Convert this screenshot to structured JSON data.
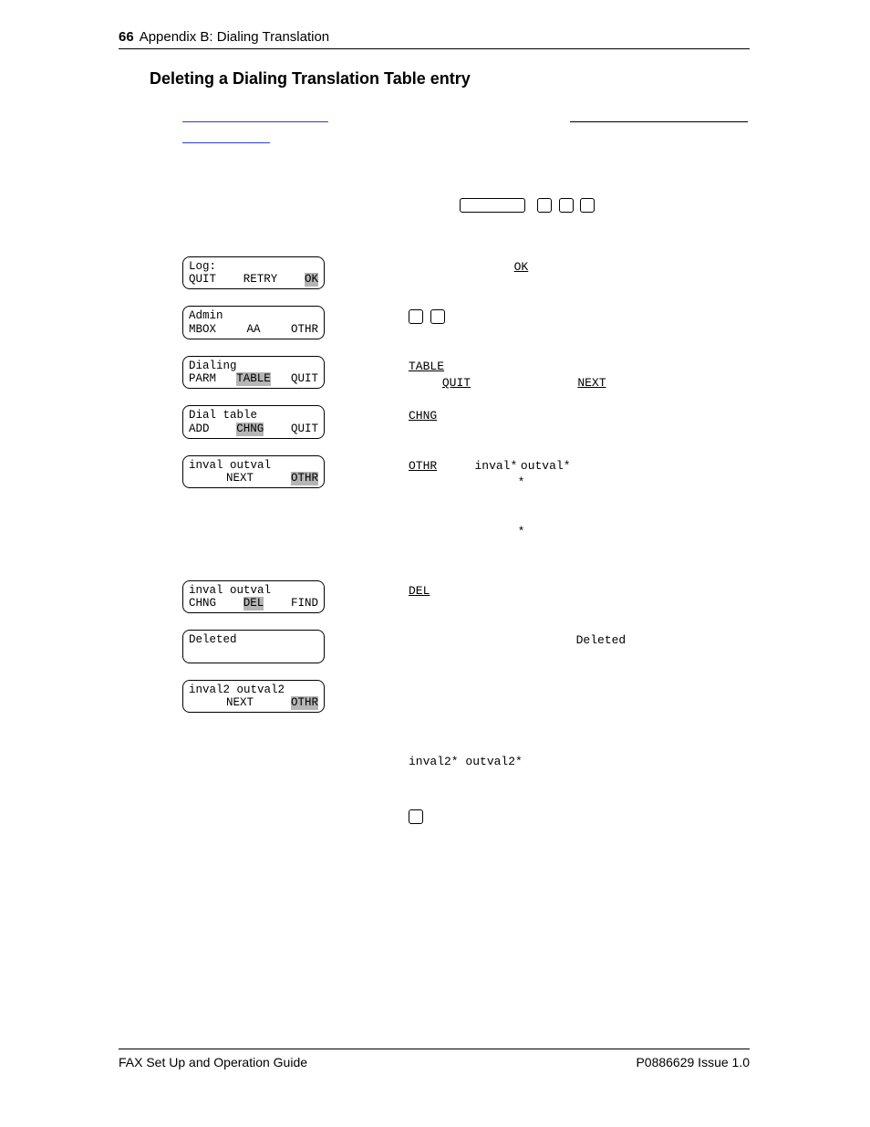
{
  "header": {
    "page_number": "66",
    "section": "Appendix B: Dialing Translation"
  },
  "title": "Deleting a Dialing Translation Table entry",
  "steps": [
    {
      "lcd_top": "Log:",
      "lcd_bl": "QUIT",
      "lcd_bc": "RETRY",
      "lcd_br": "OK",
      "hl": "OK",
      "right_key": "OK"
    },
    {
      "lcd_top": "Admin",
      "lcd_bl": "MBOX",
      "lcd_bc": "AA",
      "lcd_br": "OTHR",
      "hl": ""
    },
    {
      "lcd_top": "Dialing",
      "lcd_bl": "PARM",
      "lcd_bc": "TABLE",
      "lcd_br": "QUIT",
      "hl": "TABLE",
      "right_key1": "TABLE",
      "right_key2": "QUIT",
      "right_key3": "NEXT"
    },
    {
      "lcd_top": "Dial table",
      "lcd_bl": "ADD",
      "lcd_bc": "CHNG",
      "lcd_br": "QUIT",
      "hl": "CHNG",
      "right_key": "CHNG"
    },
    {
      "lcd_top": "inval  outval",
      "lcd_bl": "",
      "lcd_bc": "NEXT",
      "lcd_br": "OTHR",
      "hl": "OTHR",
      "right_key": "OTHR",
      "right_text1": "inval*",
      "right_text2": "outval*",
      "right_star": "*",
      "right_star2": "*"
    },
    {
      "lcd_top": "inval  outval",
      "lcd_bl": "CHNG",
      "lcd_bc": "DEL",
      "lcd_br": "FIND",
      "hl": "DEL",
      "right_key": "DEL"
    },
    {
      "lcd_top": "Deleted",
      "right_text": "Deleted"
    },
    {
      "lcd_top": "inval2  outval2",
      "lcd_bl": "",
      "lcd_bc": "NEXT",
      "lcd_br": "OTHR",
      "hl": "OTHR",
      "bottom_text": "inval2* outval2*"
    }
  ],
  "footer": {
    "left": "FAX Set Up and Operation Guide",
    "right": "P0886629 Issue 1.0"
  }
}
